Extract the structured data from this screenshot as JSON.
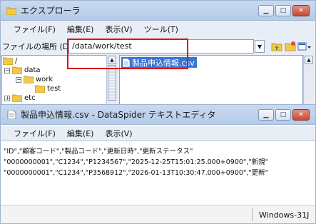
{
  "explorer": {
    "title": "エクスプローラ",
    "menu": [
      "ファイル(F)",
      "編集(E)",
      "表示(V)",
      "ツール(T)"
    ],
    "location_label": "ファイルの場所 (D)",
    "location_value": "/data/work/test",
    "tree": [
      {
        "label": "/",
        "expander": ""
      },
      {
        "label": "data",
        "expander": "⊟"
      },
      {
        "label": "work",
        "expander": "⊟"
      },
      {
        "label": "test",
        "expander": ""
      },
      {
        "label": "etc",
        "expander": "⊞"
      }
    ],
    "selected_file": "製品申込情報.csv"
  },
  "editor": {
    "title": "製品申込情報.csv - DataSpider テキストエディタ",
    "menu": [
      "ファイル(F)",
      "編集(E)",
      "表示(V)"
    ],
    "lines": [
      "\"ID\",\"顧客コード\",\"製品コード\",\"更新日時\",\"更新ステータス\"",
      "\"0000000001\",\"C1234\",\"P1234567\",\"2025-12-25T15:01:25.000+0900\",\"新規\"",
      "\"0000000001\",\"C1234\",\"P3568912\",\"2026-01-13T10:30:47.000+0900\",\"更新\""
    ],
    "status_encoding": "Windows-31J"
  },
  "colors": {
    "highlight": "#d9121a",
    "selection": "#3875d7",
    "folder": "#f2c94c",
    "close": "#c44a34"
  },
  "window_buttons": {
    "minimize": "▁",
    "maximize": "□",
    "close": "✕"
  },
  "icons": [
    "explorer-folder-icon",
    "folder-icon",
    "file-icon",
    "dropdown-arrow-icon",
    "toolbar-icon",
    "editor-doc-icon"
  ]
}
